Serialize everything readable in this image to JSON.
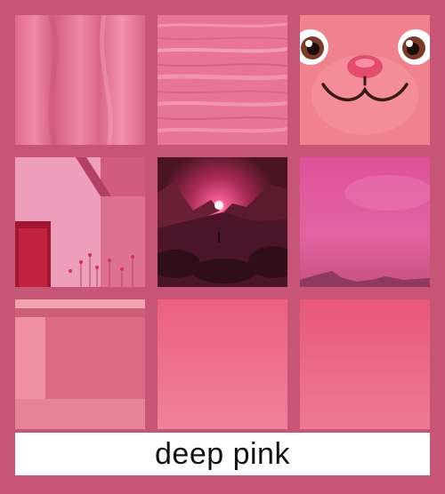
{
  "caption": "deep pink",
  "colors": {
    "background": "#c75676",
    "caption_bg": "#ffffff",
    "caption_text": "#111111"
  },
  "tiles": [
    {
      "name": "pink-silk-fabric"
    },
    {
      "name": "pink-brushstroke-texture"
    },
    {
      "name": "pink-cartoon-face"
    },
    {
      "name": "pink-house-with-red-door"
    },
    {
      "name": "pink-sunset-mountain-valley"
    },
    {
      "name": "pink-sky-with-hills"
    },
    {
      "name": "pink-rounded-box-closeup"
    },
    {
      "name": "pink-gradient-swatch"
    },
    {
      "name": "pink-gradient-swatch"
    }
  ]
}
